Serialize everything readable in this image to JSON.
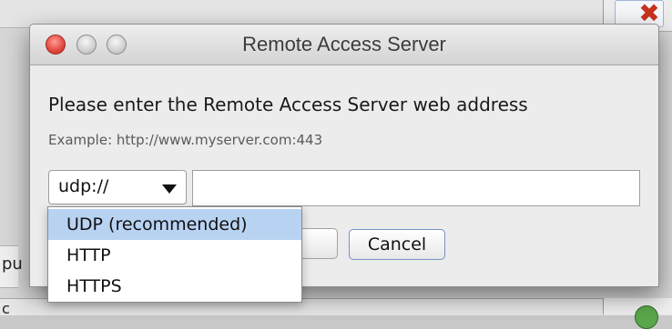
{
  "dialog": {
    "title": "Remote Access Server",
    "prompt": "Please enter the Remote Access Server web address",
    "example": "Example: http://www.myserver.com:443",
    "scheme_select": {
      "value": "udp://",
      "options": [
        "UDP (recommended)",
        "HTTP",
        "HTTPS"
      ],
      "highlighted": "UDP (recommended)"
    },
    "address_input": {
      "value": "",
      "placeholder": ""
    },
    "buttons": {
      "cancel": "Cancel"
    }
  },
  "background": {
    "left_text": "pu",
    "bottom_left_text": "c"
  },
  "colors": {
    "close_red": "#e2463c",
    "selection_blue": "#b8d2f2",
    "default_button_border": "#7394c4"
  },
  "icons": [
    "close-window-icon",
    "minimize-window-icon",
    "zoom-window-icon",
    "dropdown-arrow-icon",
    "close-x-icon",
    "status-green-icon"
  ]
}
